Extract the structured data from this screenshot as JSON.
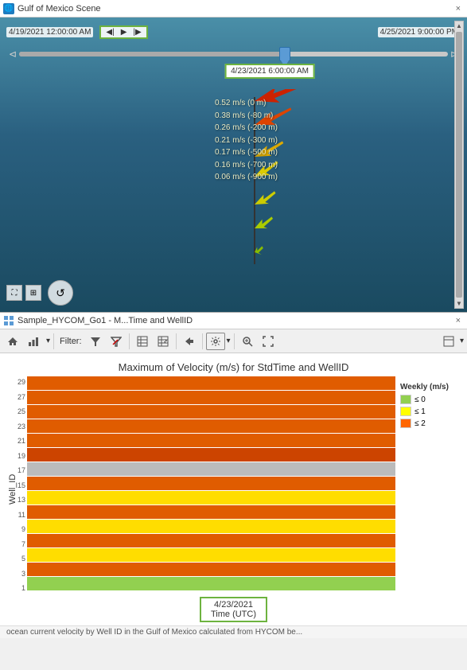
{
  "titleBar": {
    "icon": "🌐",
    "title": "Gulf of Mexico Scene",
    "closeLabel": "×"
  },
  "timeline": {
    "startTime": "4/19/2021 12:00:00 AM",
    "endTime": "4/25/2021 9:00:00 PM",
    "currentTime": "4/23/2021 6:00:00 AM",
    "sliderPercent": 62,
    "playBtn": "▶",
    "prevBtn": "◀|",
    "nextBtn": "|▶"
  },
  "velocityLabels": [
    "0.52 m/s (0 m)",
    "0.38 m/s (-80 m)",
    "0.26 m/s (-200 m)",
    "0.21 m/s (-300 m)",
    "0.17 m/s (-500 m)",
    "0.16 m/s (-700 m)",
    "0.06 m/s (-900 m)"
  ],
  "bottomPanel": {
    "title": "Sample_HYCOM_Go1 - M...Time and WellID",
    "closeLabel": "×"
  },
  "toolbar": {
    "filterLabel": "Filter:",
    "buttons": [
      "home",
      "bar-chart",
      "filter",
      "filter-exclude",
      "table",
      "export",
      "arrow-left",
      "settings",
      "zoom-in",
      "expand",
      "more"
    ]
  },
  "chart": {
    "title": "Maximum of Velocity (m/s) for StdTime and WellID",
    "yAxisLabel": "Well_ID",
    "xAxisLabel": "Time (UTC)",
    "xAnnotation": "4/23/2021",
    "yTicks": [
      "29",
      "27",
      "25",
      "23",
      "21",
      "19",
      "17",
      "15",
      "13",
      "11",
      "9",
      "7",
      "5",
      "3",
      "1"
    ],
    "legend": {
      "title": "Weekly (m/s)",
      "items": [
        {
          "label": "≤ 0",
          "color": "#92d050"
        },
        {
          "label": "≤ 1",
          "color": "#ffff00"
        },
        {
          "label": "≤ 2",
          "color": "#ff6600"
        }
      ]
    },
    "rows": [
      {
        "wellId": 29,
        "color": "#e05c00"
      },
      {
        "wellId": 27,
        "color": "#e05c00"
      },
      {
        "wellId": 25,
        "color": "#e05c00"
      },
      {
        "wellId": 23,
        "color": "#e05c00"
      },
      {
        "wellId": 21,
        "color": "#e05c00"
      },
      {
        "wellId": 19,
        "color": "#cc4400"
      },
      {
        "wellId": 17,
        "color": "#bbbbbb"
      },
      {
        "wellId": 15,
        "color": "#e05c00"
      },
      {
        "wellId": 13,
        "color": "#ffdd00"
      },
      {
        "wellId": 11,
        "color": "#e05c00"
      },
      {
        "wellId": 9,
        "color": "#ffdd00"
      },
      {
        "wellId": 7,
        "color": "#e05c00"
      },
      {
        "wellId": 5,
        "color": "#ffdd00"
      },
      {
        "wellId": 3,
        "color": "#e05c00"
      },
      {
        "wellId": 1,
        "color": "#92d050"
      }
    ]
  },
  "footer": {
    "text": "ocean current velocity by Well ID in the Gulf of Mexico calculated from HYCOM be..."
  }
}
